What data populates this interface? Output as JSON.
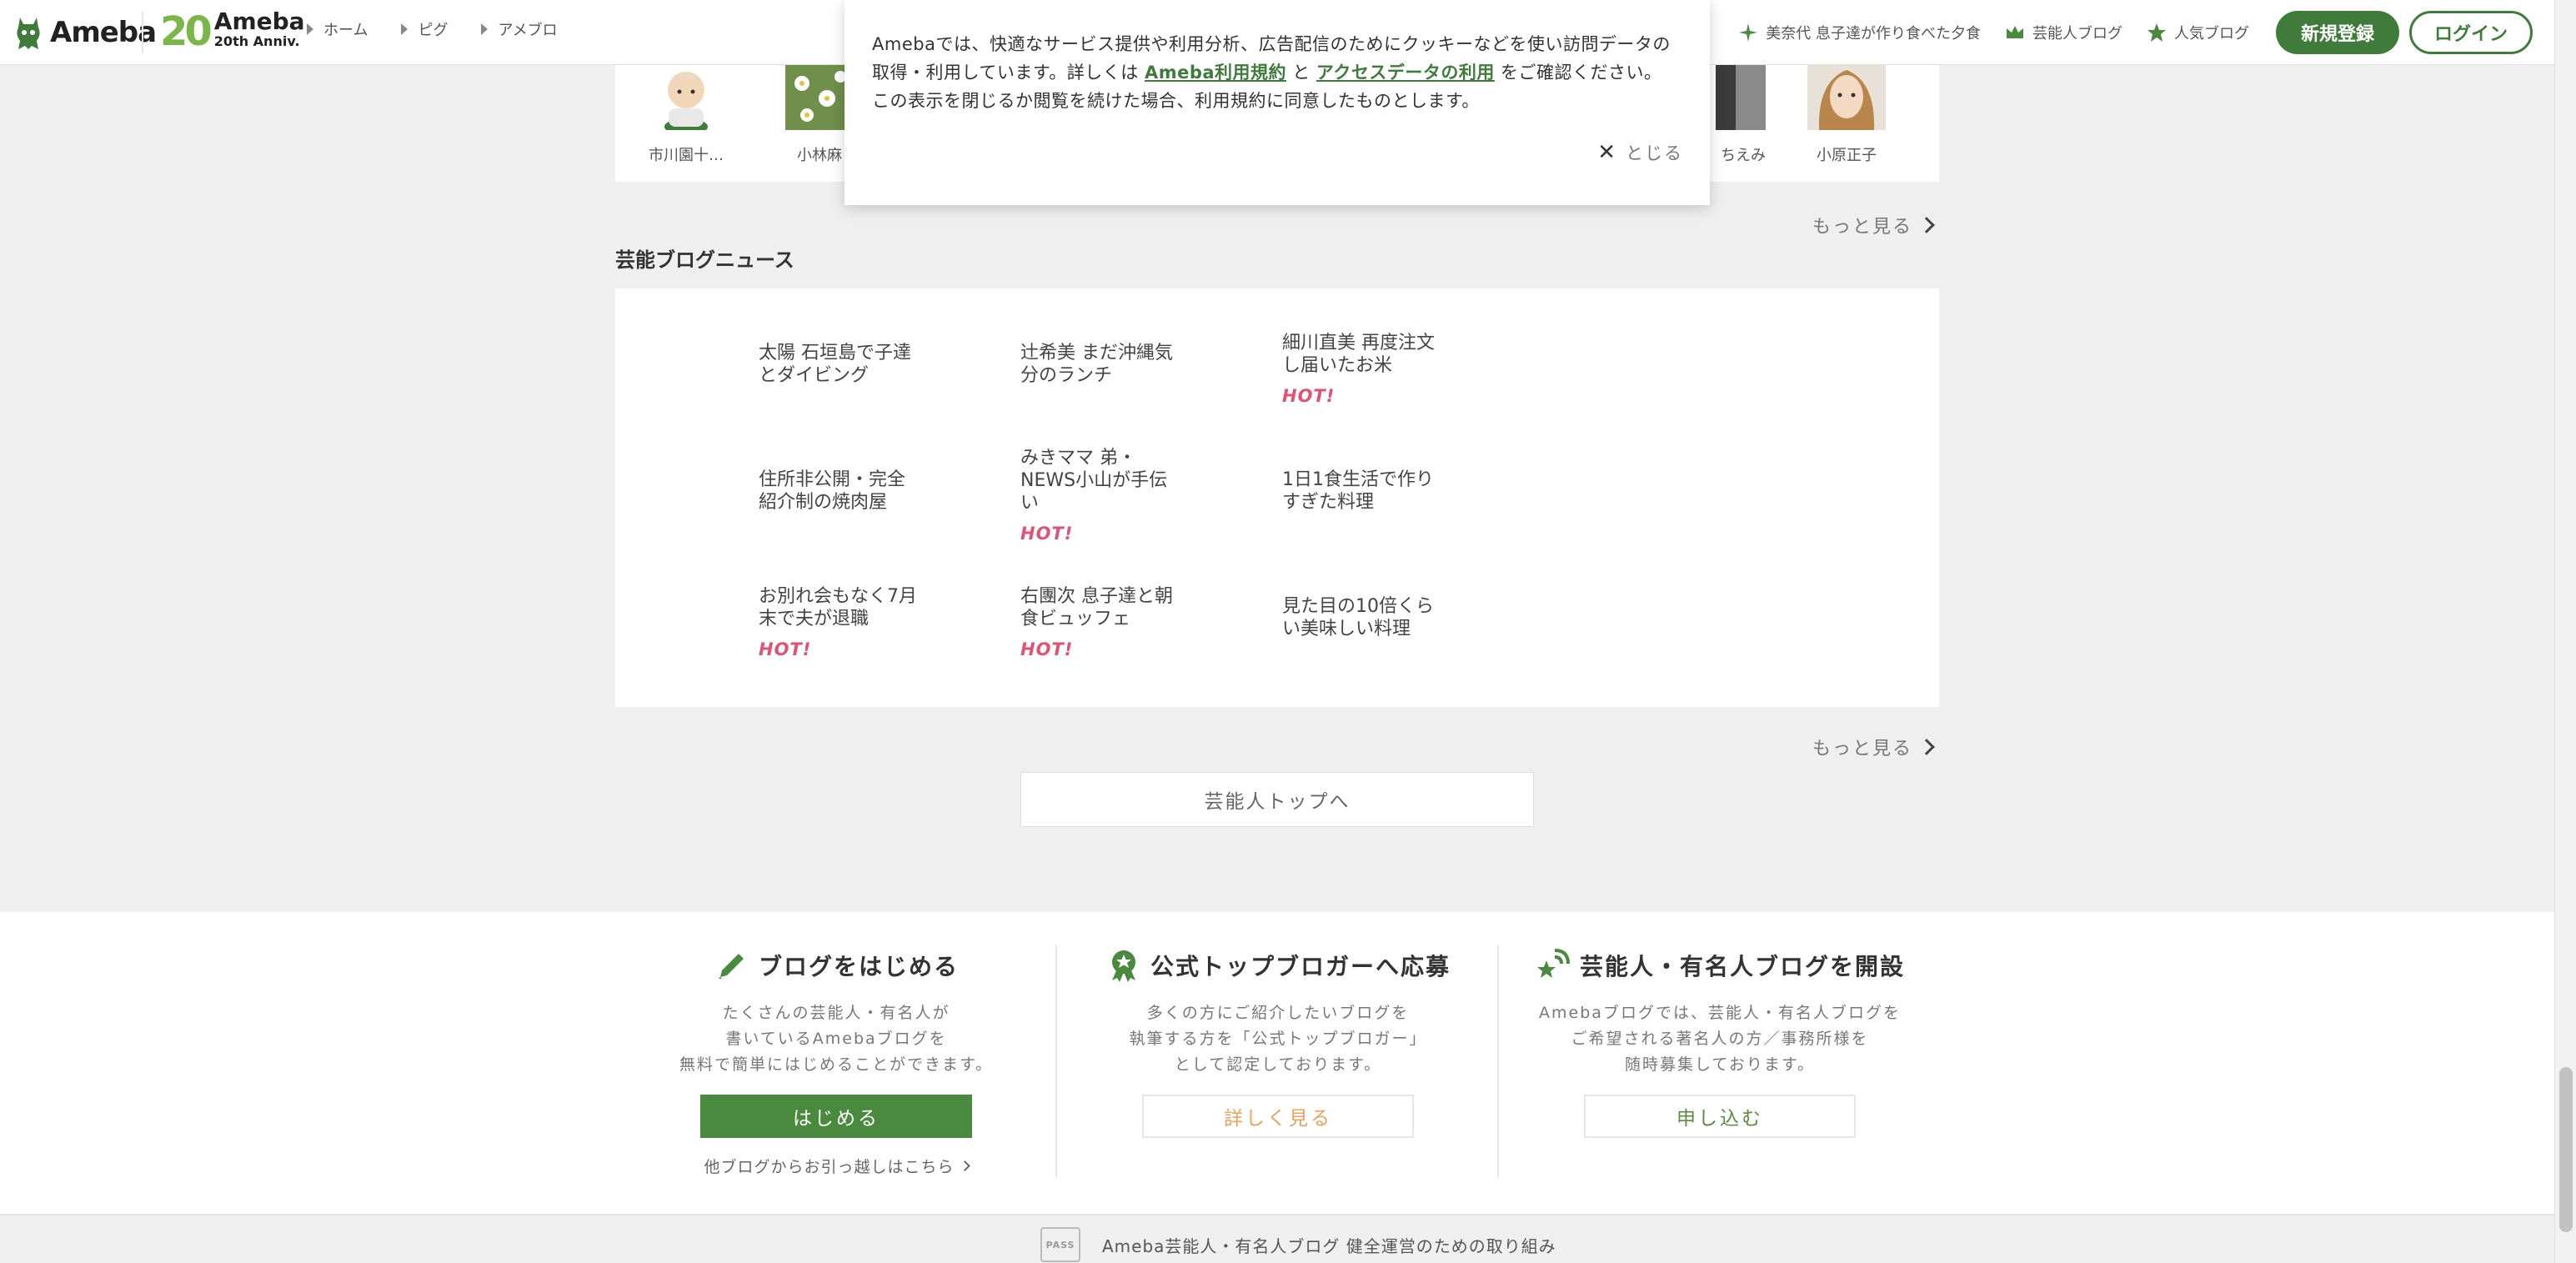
{
  "header": {
    "logo_text": "Ameba",
    "anniv_number": "20",
    "anniv_title": "Ameba",
    "anniv_sub": "20th Anniv.",
    "nav": [
      "ホーム",
      "ピグ",
      "アメブロ"
    ],
    "links": [
      {
        "label": "美奈代 息子達が作り食べた夕食",
        "icon": "sparkle-icon"
      },
      {
        "label": "芸能人ブログ",
        "icon": "crown-icon"
      },
      {
        "label": "人気ブログ",
        "icon": "star-icon"
      }
    ],
    "register_label": "新規登録",
    "login_label": "ログイン"
  },
  "cookie": {
    "text_1": "Amebaでは、快適なサービス提供や利用分析、広告配信のためにクッキーなどを使い訪問データの取得・利用しています。詳しくは ",
    "link_terms": "Ameba利用規約",
    "text_2": " と ",
    "link_access": "アクセスデータの利用",
    "text_3": " をご確認ください。この表示を閉じるか閲覧を続けた場合、利用規約に同意したものとします。",
    "close_label": "とじる"
  },
  "bloggers": [
    {
      "name": "市川園十…"
    },
    {
      "name": "小林麻"
    },
    {
      "name": "ちえみ"
    },
    {
      "name": "小原正子"
    }
  ],
  "more_label": "もっと見る",
  "news": {
    "title": "芸能ブログニュース",
    "hot_label": "HOT!",
    "items": [
      {
        "text": "太陽 石垣島で子達とダイビング",
        "hot": false
      },
      {
        "text": "辻希美 まだ沖縄気分のランチ",
        "hot": false
      },
      {
        "text": "細川直美 再度注文し届いたお米",
        "hot": true
      },
      {
        "text": "住所非公開・完全紹介制の焼肉屋",
        "hot": false
      },
      {
        "text": "みきママ 弟・NEWS小山が手伝い",
        "hot": true
      },
      {
        "text": "1日1食生活で作りすぎた料理",
        "hot": false
      },
      {
        "text": "お別れ会もなく7月末で夫が退職",
        "hot": true
      },
      {
        "text": "右團次 息子達と朝食ビュッフェ",
        "hot": true
      },
      {
        "text": "見た目の10倍くらい美味しい料理",
        "hot": false
      }
    ]
  },
  "top_button_label": "芸能人トップへ",
  "promo": {
    "start": {
      "title": "ブログをはじめる",
      "desc": [
        "たくさんの芸能人・有名人が",
        "書いているAmebaブログを",
        "無料で簡単にはじめることができます。"
      ],
      "button": "はじめる",
      "move_link": "他ブログからお引っ越しはこちら"
    },
    "official": {
      "title": "公式トップブロガーへ応募",
      "desc": [
        "多くの方にご紹介したいブログを",
        "執筆する方を「公式トップブロガー」",
        "として認定しております。"
      ],
      "button": "詳しく見る"
    },
    "celebrity": {
      "title": "芸能人・有名人ブログを開設",
      "desc": [
        "Amebaブログでは、芸能人・有名人ブログを",
        "ご希望される著名人の方／事務所様を",
        "随時募集しております。"
      ],
      "button": "申し込む"
    }
  },
  "pass_badge": "PASS",
  "pass_text": "Ameba芸能人・有名人ブログ 健全運営のための取り組み",
  "colors": {
    "brand_green": "#3f7c3b",
    "hot_pink": "#e05273",
    "background": "#efefef"
  }
}
